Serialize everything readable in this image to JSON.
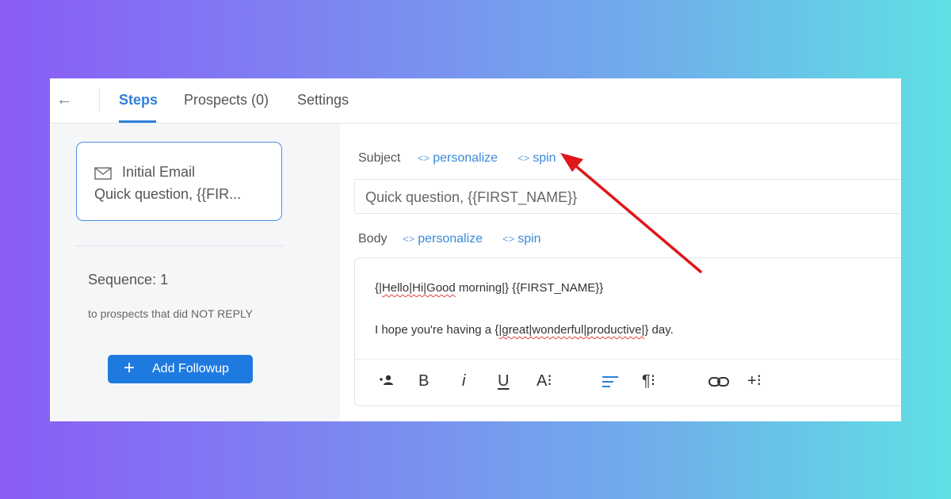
{
  "nav": {
    "back_icon": "←",
    "tabs": [
      {
        "label": "Steps",
        "active": true
      },
      {
        "label": "Prospects (0)",
        "active": false
      },
      {
        "label": "Settings",
        "active": false
      }
    ]
  },
  "sidebar": {
    "step": {
      "icon": "mail-icon",
      "title": "Initial Email",
      "subject_preview": "Quick question, {{FIR..."
    },
    "sequence": {
      "title": "Sequence: 1",
      "description": "to prospects that did NOT REPLY"
    },
    "add_followup_label": "Add Followup"
  },
  "editor": {
    "subject": {
      "label": "Subject",
      "personalize_label": "personalize",
      "spin_label": "spin",
      "value": "Quick question, {{FIRST_NAME}}"
    },
    "body": {
      "label": "Body",
      "personalize_label": "personalize",
      "spin_label": "spin",
      "line1": {
        "prefix": "{|",
        "misspelled": "Hello|Hi|Good",
        "suffix": " morning|} {{FIRST_NAME}}"
      },
      "line2": {
        "prefix": "I hope you're having a {",
        "misspelled": "|great|wonderful|productive|",
        "suffix": "} day."
      }
    },
    "toolbar": {
      "bold": "B",
      "italic": "i",
      "underline": "U",
      "font_size": "A⁝",
      "paragraph": "¶⁝",
      "more": "+⁝"
    },
    "link_icon": "<>"
  },
  "colors": {
    "accent": "#2f7fd8",
    "button": "#1f7ae0",
    "annotation_arrow": "#e0161b"
  }
}
